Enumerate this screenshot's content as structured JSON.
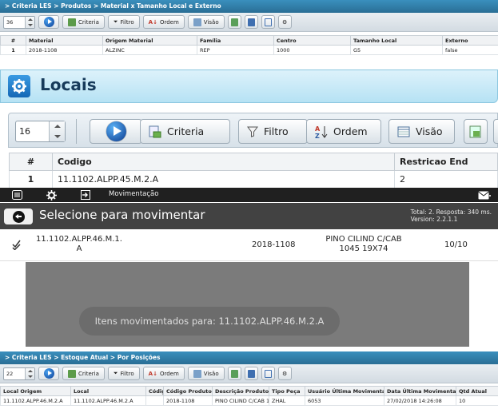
{
  "top_panel": {
    "breadcrumb": "> Criteria LES > Produtos > Material x Tamanho Local e Externo",
    "page_size": "36",
    "toolbar": {
      "criteria": "Criteria",
      "filtro": "Filtro",
      "ordem": "Ordem",
      "visao": "Visão"
    },
    "columns": [
      "#",
      "Material",
      "Origem Material",
      "Família",
      "Centro",
      "Tamanho Local",
      "Externo"
    ],
    "rows": [
      [
        "1",
        "2018-1108",
        "ALZINC",
        "REP",
        "1000",
        "G5",
        "false"
      ]
    ]
  },
  "locais_panel": {
    "title": "Locais",
    "page_size": "16",
    "toolbar": {
      "criteria": "Criteria",
      "filtro": "Filtro",
      "ordem": "Ordem",
      "visao": "Visão"
    },
    "columns": [
      "#",
      "Codigo",
      "Restricao End"
    ],
    "rows": [
      [
        "1",
        "11.1102.ALPP.45.M.2.A",
        "2"
      ]
    ]
  },
  "mobile": {
    "appbar_title": "Movimentação",
    "subheader_title": "Selecione para movimentar",
    "info_line1": "Total: 2. Resposta: 340 ms.",
    "info_line2": "Version: 2.2.1.1",
    "item": {
      "location_line1": "11.1102.ALPP.46.M.1.",
      "location_line2": "A",
      "material": "2018-1108",
      "desc_line1": "PINO CILIND C/CAB",
      "desc_line2": "1045 19X74",
      "qty": "10/10"
    },
    "toast": "Itens movimentados para: 11.1102.ALPP.46.M.2.A"
  },
  "bottom_panel": {
    "breadcrumb": "> Criteria LES > Estoque Atual > Por Posições",
    "page_size": "22",
    "toolbar": {
      "criteria": "Criteria",
      "filtro": "Filtro",
      "ordem": "Ordem",
      "visao": "Visão"
    },
    "columns": [
      "Local Origem",
      "Local",
      "Códig",
      "Código Produto",
      "Descrição Produto",
      "Tipo Peça",
      "Usuário Última Movimentação",
      "Data Última Movimentação",
      "Qtd Atual"
    ],
    "rows": [
      [
        "11.1102.ALPP.46.M.2.A",
        "11.1102.ALPP.46.M.2.A",
        "",
        "2018-1108",
        "PINO CILIND C/CAB 1(",
        "ZHAL",
        "6053",
        "27/02/2018 14:26:08",
        "10"
      ]
    ]
  },
  "colors": {
    "breadcrumb_bar": "#2a6e95",
    "locais_header": "#b6e2f4",
    "appbar": "#202020",
    "subheader": "#424242",
    "toast_bg": "#7b7b7b"
  }
}
